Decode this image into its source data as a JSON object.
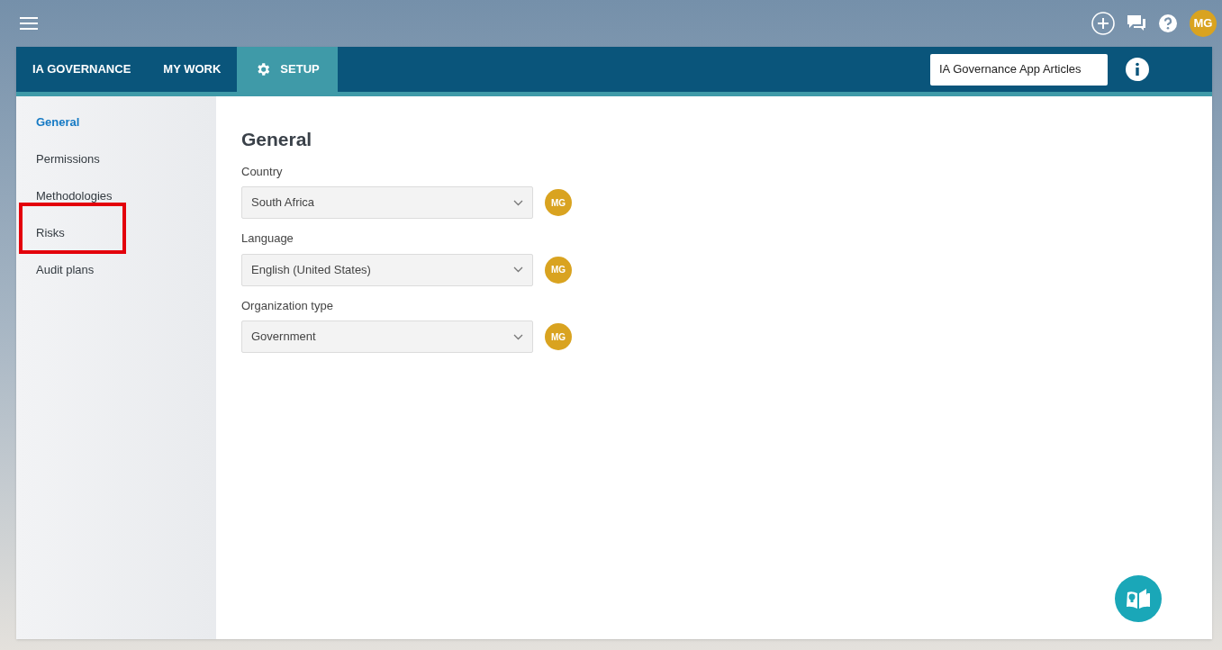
{
  "top_bar": {
    "avatar": "MG"
  },
  "nav": {
    "tabs": [
      {
        "label": "IA GOVERNANCE",
        "selected": false,
        "kind": "text"
      },
      {
        "label": "MY WORK",
        "selected": false,
        "kind": "text"
      },
      {
        "label": "SETUP",
        "selected": true,
        "kind": "gear"
      }
    ],
    "search": {
      "value": "IA Governance App Articles"
    }
  },
  "sidebar": {
    "items": [
      {
        "label": "General",
        "selected": true,
        "highlighted": false
      },
      {
        "label": "Permissions",
        "selected": false,
        "highlighted": false
      },
      {
        "label": "Methodologies",
        "selected": false,
        "highlighted": false
      },
      {
        "label": "Risks",
        "selected": false,
        "highlighted": true
      },
      {
        "label": "Audit plans",
        "selected": false,
        "highlighted": false
      }
    ]
  },
  "content": {
    "title": "General",
    "fields": [
      {
        "label": "Country",
        "value": "South Africa",
        "avatar": "MG"
      },
      {
        "label": "Language",
        "value": "English (United States)",
        "avatar": "MG"
      },
      {
        "label": "Organization type",
        "value": "Government",
        "avatar": "MG"
      }
    ]
  }
}
